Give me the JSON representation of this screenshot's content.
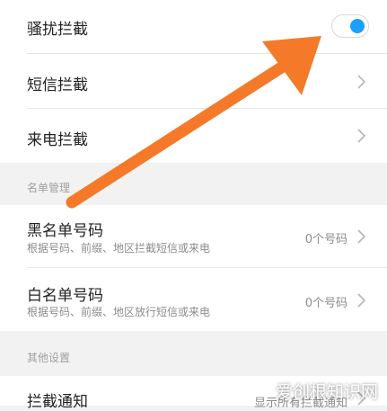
{
  "harassment": {
    "title": "骚扰拦截",
    "toggle_on": true,
    "accent": "#1aa0ff"
  },
  "sms": {
    "title": "短信拦截"
  },
  "call": {
    "title": "来电拦截"
  },
  "list_section": {
    "label": "名单管理",
    "blacklist": {
      "title": "黑名单号码",
      "subtitle": "根据号码、前缀、地区拦截短信或来电",
      "value": "0个号码"
    },
    "whitelist": {
      "title": "白名单号码",
      "subtitle": "根据号码、前缀、地区放行短信或来电",
      "value": "0个号码"
    }
  },
  "other_section": {
    "label": "其他设置",
    "notify": {
      "title": "拦截通知",
      "value": "显示所有拦截通知"
    }
  },
  "annotation": {
    "arrow_color": "#f47a2a"
  },
  "watermark": "爱创根知识网"
}
